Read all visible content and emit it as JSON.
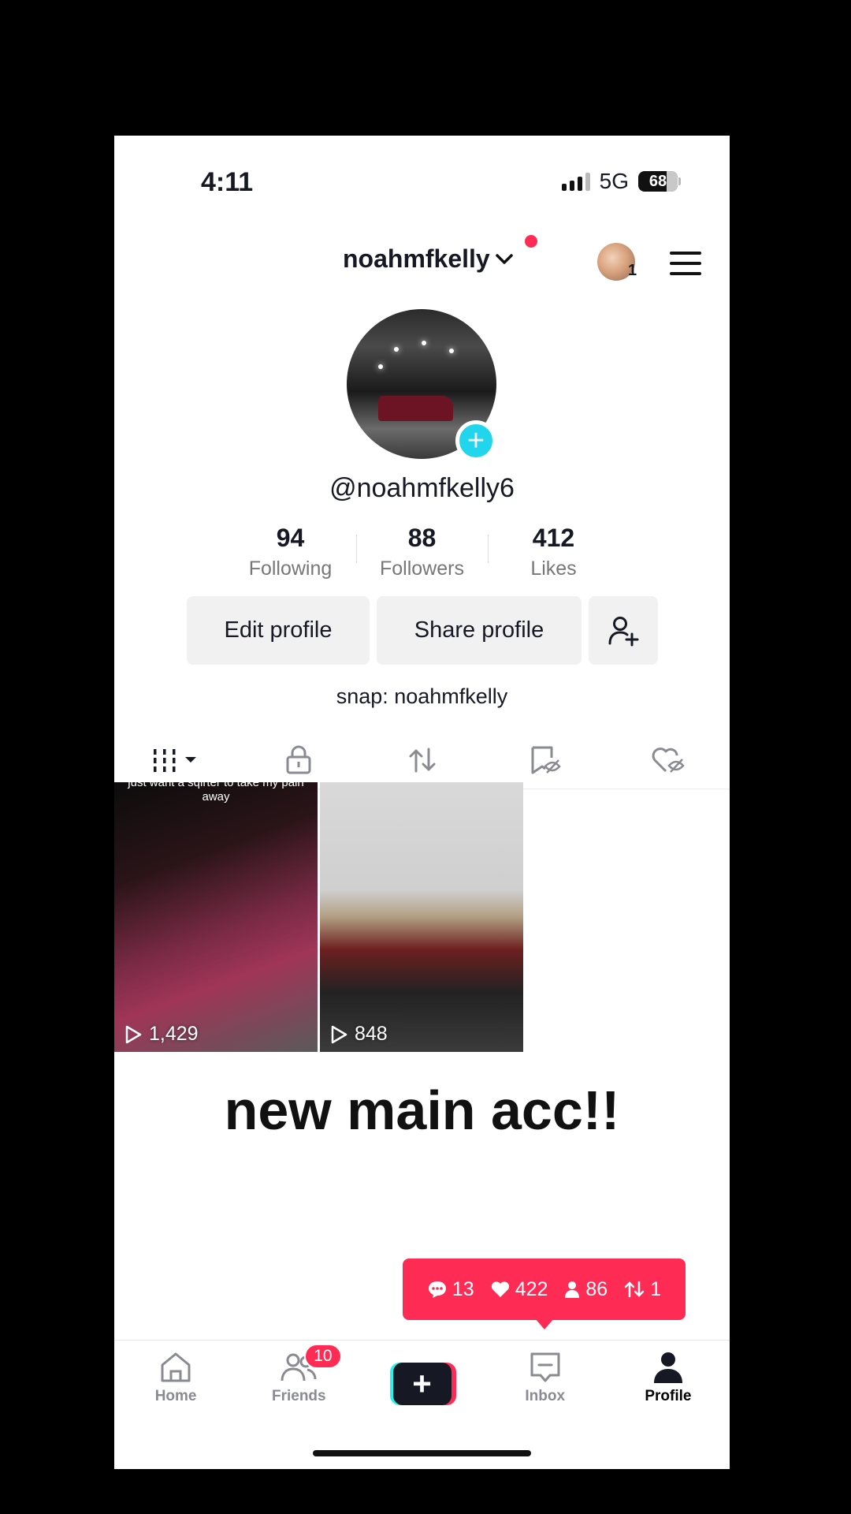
{
  "status_bar": {
    "time": "4:11",
    "network": "5G",
    "battery": "68"
  },
  "header": {
    "username": "noahmfkelly",
    "account_count": "1"
  },
  "profile": {
    "handle": "@noahmfkelly6",
    "bio": "snap: noahmfkelly"
  },
  "stats": [
    {
      "value": "94",
      "label": "Following"
    },
    {
      "value": "88",
      "label": "Followers"
    },
    {
      "value": "412",
      "label": "Likes"
    }
  ],
  "actions": {
    "edit_label": "Edit profile",
    "share_label": "Share profile"
  },
  "tabs": [
    "videos-grid-icon",
    "lock-icon",
    "repost-icon",
    "favorites-icon",
    "liked-icon"
  ],
  "videos": [
    {
      "caption": "just want a sqirter to take my pain away",
      "views": "1,429"
    },
    {
      "views": "848"
    }
  ],
  "main_text": "new main acc!!",
  "notification": {
    "comments": "13",
    "likes": "422",
    "followers": "86",
    "reposts": "1"
  },
  "nav": {
    "home": "Home",
    "friends": "Friends",
    "friends_badge": "10",
    "inbox": "Inbox",
    "profile": "Profile"
  },
  "colors": {
    "accent": "#fe2c55",
    "cyan": "#25f4ee",
    "badge_plus": "#20d5ec"
  }
}
